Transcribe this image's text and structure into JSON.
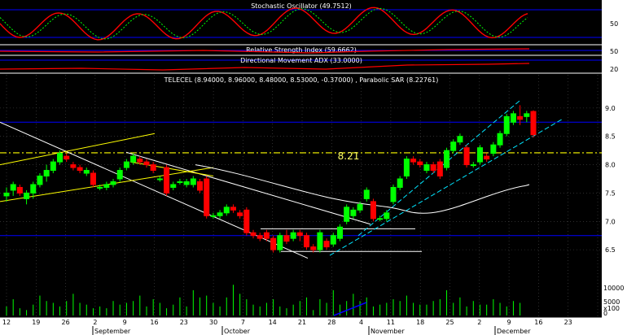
{
  "colors": {
    "background": "#000000",
    "axis_panel": "#ffffff",
    "grid": "#4a4a4a",
    "blue_line": "#0000ff",
    "white": "#ffffff",
    "red": "#ff0000",
    "green": "#00ff00",
    "yellow": "#ffff00",
    "cyan": "#00e5ff",
    "up_candle": "#00ff00",
    "down_candle": "#ff0000"
  },
  "panels": {
    "stochastic": {
      "title": "Stochastic Oscillator (49.7512)",
      "ticks": [
        "50"
      ]
    },
    "rsi": {
      "title": "Relative Strength Index (59.6662)",
      "ticks": [
        "50"
      ]
    },
    "adx": {
      "title": "Directional Movement ADX (33.0000)",
      "ticks": [
        "20"
      ]
    }
  },
  "chart_data": {
    "type": "candlestick",
    "title": "TELECEL (8.94000, 8.96000, 8.48000, 8.53000, -0.37000) , Parabolic SAR (8.22761)",
    "annotation": "8.21",
    "y_ticks": [
      "9.0",
      "8.5",
      "8.0",
      "7.5",
      "7.0",
      "6.5"
    ],
    "ylim": [
      6.1,
      9.4
    ],
    "volume_ticks": [
      "10000",
      "5000",
      "0",
      "x100"
    ],
    "x_ticks": [
      "12",
      "19",
      "26",
      "2",
      "9",
      "16",
      "23",
      "30",
      "7",
      "14",
      "21",
      "28",
      "4",
      "11",
      "18",
      "25",
      "2",
      "9",
      "16",
      "23"
    ],
    "months": [
      "September",
      "October",
      "November",
      "December"
    ],
    "candles": [
      {
        "o": 7.45,
        "h": 7.6,
        "l": 7.35,
        "c": 7.5
      },
      {
        "o": 7.55,
        "h": 7.7,
        "l": 7.45,
        "c": 7.65
      },
      {
        "o": 7.6,
        "h": 7.65,
        "l": 7.45,
        "c": 7.5
      },
      {
        "o": 7.4,
        "h": 7.55,
        "l": 7.3,
        "c": 7.5
      },
      {
        "o": 7.5,
        "h": 7.7,
        "l": 7.4,
        "c": 7.65
      },
      {
        "o": 7.65,
        "h": 7.85,
        "l": 7.6,
        "c": 7.8
      },
      {
        "o": 7.8,
        "h": 8.0,
        "l": 7.7,
        "c": 7.9
      },
      {
        "o": 7.9,
        "h": 8.1,
        "l": 7.85,
        "c": 8.05
      },
      {
        "o": 8.05,
        "h": 8.25,
        "l": 8.0,
        "c": 8.2
      },
      {
        "o": 8.15,
        "h": 8.2,
        "l": 8.05,
        "c": 8.1
      },
      {
        "o": 8.0,
        "h": 8.05,
        "l": 7.9,
        "c": 7.95
      },
      {
        "o": 7.95,
        "h": 8.0,
        "l": 7.85,
        "c": 7.9
      },
      {
        "o": 7.85,
        "h": 7.95,
        "l": 7.8,
        "c": 7.9
      },
      {
        "o": 7.85,
        "h": 7.9,
        "l": 7.6,
        "c": 7.65
      },
      {
        "o": 7.6,
        "h": 7.65,
        "l": 7.55,
        "c": 7.6
      },
      {
        "o": 7.6,
        "h": 7.7,
        "l": 7.55,
        "c": 7.65
      },
      {
        "o": 7.65,
        "h": 7.75,
        "l": 7.6,
        "c": 7.7
      },
      {
        "o": 7.75,
        "h": 7.95,
        "l": 7.7,
        "c": 7.9
      },
      {
        "o": 7.95,
        "h": 8.1,
        "l": 7.9,
        "c": 8.05
      },
      {
        "o": 8.05,
        "h": 8.2,
        "l": 8.0,
        "c": 8.15
      },
      {
        "o": 8.1,
        "h": 8.15,
        "l": 8.0,
        "c": 8.05
      },
      {
        "o": 8.05,
        "h": 8.1,
        "l": 7.95,
        "c": 8.0
      },
      {
        "o": 8.0,
        "h": 8.05,
        "l": 7.85,
        "c": 7.9
      },
      {
        "o": 7.75,
        "h": 7.8,
        "l": 7.7,
        "c": 7.75
      },
      {
        "o": 7.95,
        "h": 8.0,
        "l": 7.45,
        "c": 7.5
      },
      {
        "o": 7.6,
        "h": 7.7,
        "l": 7.55,
        "c": 7.65
      },
      {
        "o": 7.7,
        "h": 7.75,
        "l": 7.65,
        "c": 7.7
      },
      {
        "o": 7.65,
        "h": 7.75,
        "l": 7.6,
        "c": 7.7
      },
      {
        "o": 7.65,
        "h": 7.8,
        "l": 7.6,
        "c": 7.75
      },
      {
        "o": 7.7,
        "h": 7.75,
        "l": 7.5,
        "c": 7.55
      },
      {
        "o": 7.75,
        "h": 7.8,
        "l": 7.05,
        "c": 7.1
      },
      {
        "o": 7.1,
        "h": 7.15,
        "l": 7.05,
        "c": 7.1
      },
      {
        "o": 7.1,
        "h": 7.2,
        "l": 7.05,
        "c": 7.15
      },
      {
        "o": 7.15,
        "h": 7.3,
        "l": 7.1,
        "c": 7.25
      },
      {
        "o": 7.25,
        "h": 7.3,
        "l": 7.15,
        "c": 7.2
      },
      {
        "o": 7.15,
        "h": 7.2,
        "l": 7.05,
        "c": 7.1
      },
      {
        "o": 7.2,
        "h": 7.25,
        "l": 6.75,
        "c": 6.8
      },
      {
        "o": 6.8,
        "h": 6.85,
        "l": 6.7,
        "c": 6.75
      },
      {
        "o": 6.75,
        "h": 6.8,
        "l": 6.65,
        "c": 6.7
      },
      {
        "o": 6.8,
        "h": 6.85,
        "l": 6.65,
        "c": 6.7
      },
      {
        "o": 6.7,
        "h": 6.75,
        "l": 6.45,
        "c": 6.5
      },
      {
        "o": 6.5,
        "h": 6.8,
        "l": 6.45,
        "c": 6.75
      },
      {
        "o": 6.75,
        "h": 6.85,
        "l": 6.6,
        "c": 6.65
      },
      {
        "o": 6.7,
        "h": 6.85,
        "l": 6.65,
        "c": 6.8
      },
      {
        "o": 6.8,
        "h": 6.85,
        "l": 6.65,
        "c": 6.75
      },
      {
        "o": 6.75,
        "h": 6.8,
        "l": 6.5,
        "c": 6.55
      },
      {
        "o": 6.55,
        "h": 6.6,
        "l": 6.45,
        "c": 6.5
      },
      {
        "o": 6.5,
        "h": 6.85,
        "l": 6.45,
        "c": 6.8
      },
      {
        "o": 6.65,
        "h": 6.7,
        "l": 6.5,
        "c": 6.55
      },
      {
        "o": 6.6,
        "h": 6.8,
        "l": 6.55,
        "c": 6.75
      },
      {
        "o": 6.7,
        "h": 6.95,
        "l": 6.65,
        "c": 6.9
      },
      {
        "o": 7.0,
        "h": 7.3,
        "l": 6.95,
        "c": 7.25
      },
      {
        "o": 7.1,
        "h": 7.25,
        "l": 7.05,
        "c": 7.2
      },
      {
        "o": 7.2,
        "h": 7.35,
        "l": 7.15,
        "c": 7.3
      },
      {
        "o": 7.4,
        "h": 7.6,
        "l": 7.35,
        "c": 7.55
      },
      {
        "o": 7.35,
        "h": 7.4,
        "l": 7.0,
        "c": 7.05
      },
      {
        "o": 7.05,
        "h": 7.1,
        "l": 7.0,
        "c": 7.05
      },
      {
        "o": 7.05,
        "h": 7.2,
        "l": 7.0,
        "c": 7.15
      },
      {
        "o": 7.35,
        "h": 7.65,
        "l": 7.3,
        "c": 7.6
      },
      {
        "o": 7.6,
        "h": 7.8,
        "l": 7.55,
        "c": 7.75
      },
      {
        "o": 7.8,
        "h": 8.15,
        "l": 7.75,
        "c": 8.1
      },
      {
        "o": 8.1,
        "h": 8.15,
        "l": 8.0,
        "c": 8.05
      },
      {
        "o": 8.05,
        "h": 8.1,
        "l": 7.95,
        "c": 8.0
      },
      {
        "o": 7.9,
        "h": 8.05,
        "l": 7.85,
        "c": 8.0
      },
      {
        "o": 8.0,
        "h": 8.05,
        "l": 7.85,
        "c": 7.9
      },
      {
        "o": 8.05,
        "h": 8.1,
        "l": 7.75,
        "c": 7.8
      },
      {
        "o": 7.95,
        "h": 8.3,
        "l": 7.9,
        "c": 8.25
      },
      {
        "o": 8.25,
        "h": 8.45,
        "l": 8.2,
        "c": 8.4
      },
      {
        "o": 8.4,
        "h": 8.55,
        "l": 8.35,
        "c": 8.5
      },
      {
        "o": 8.3,
        "h": 8.35,
        "l": 7.95,
        "c": 8.0
      },
      {
        "o": 8.0,
        "h": 8.05,
        "l": 7.95,
        "c": 8.0
      },
      {
        "o": 8.05,
        "h": 8.35,
        "l": 8.0,
        "c": 8.3
      },
      {
        "o": 8.15,
        "h": 8.2,
        "l": 8.05,
        "c": 8.1
      },
      {
        "o": 8.2,
        "h": 8.4,
        "l": 8.15,
        "c": 8.35
      },
      {
        "o": 8.35,
        "h": 8.6,
        "l": 8.3,
        "c": 8.55
      },
      {
        "o": 8.55,
        "h": 8.9,
        "l": 8.5,
        "c": 8.85
      },
      {
        "o": 8.75,
        "h": 8.95,
        "l": 8.7,
        "c": 8.9
      },
      {
        "o": 8.85,
        "h": 9.05,
        "l": 8.7,
        "c": 8.8
      },
      {
        "o": 8.85,
        "h": 8.95,
        "l": 8.75,
        "c": 8.9
      },
      {
        "o": 8.94,
        "h": 8.96,
        "l": 8.48,
        "c": 8.53
      }
    ],
    "volume": [
      5,
      9,
      4,
      3,
      6,
      11,
      8,
      7,
      5,
      8,
      12,
      7,
      6,
      4,
      5,
      4,
      8,
      6,
      7,
      8,
      11,
      5,
      9,
      7,
      4,
      6,
      10,
      5,
      14,
      10,
      11,
      7,
      5,
      10,
      17,
      12,
      9,
      6,
      5,
      7,
      9,
      5,
      4,
      6,
      8,
      10,
      3,
      9,
      7,
      14,
      6,
      8,
      12,
      8,
      10,
      5,
      6,
      7,
      9,
      8,
      11,
      7,
      6,
      6,
      8,
      9,
      14,
      7,
      10,
      5,
      8,
      6,
      6,
      9,
      7,
      5,
      8,
      7
    ]
  }
}
